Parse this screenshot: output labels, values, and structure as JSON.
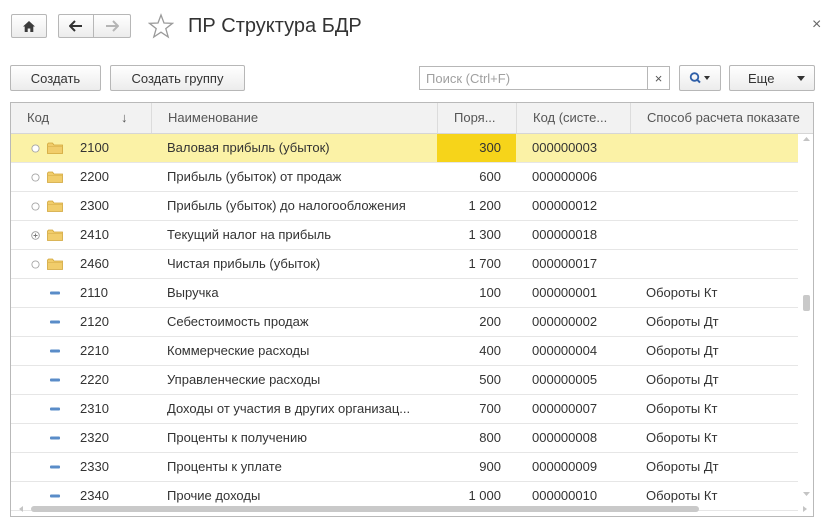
{
  "window": {
    "title": "ПР Структура БДР"
  },
  "toolbar": {
    "create_label": "Создать",
    "create_group_label": "Создать группу",
    "search_placeholder": "Поиск (Ctrl+F)",
    "search_clear_label": "×",
    "more_label": "Еще"
  },
  "table": {
    "columns": [
      "Код",
      "Наименование",
      "Поря...",
      "Код (систе...",
      "Способ расчета показате..."
    ],
    "sort_indicator": "↓",
    "rows": [
      {
        "kind": "group",
        "marker": "circle",
        "code": "2100",
        "name": "Валовая прибыль (убыток)",
        "order": "300",
        "sys_code": "000000003",
        "method": "",
        "selected": true
      },
      {
        "kind": "group",
        "marker": "circle",
        "code": "2200",
        "name": "Прибыль (убыток) от продаж",
        "order": "600",
        "sys_code": "000000006",
        "method": ""
      },
      {
        "kind": "group",
        "marker": "circle",
        "code": "2300",
        "name": "Прибыль (убыток) до налогообложения",
        "order": "1 200",
        "sys_code": "000000012",
        "method": ""
      },
      {
        "kind": "group",
        "marker": "plus",
        "code": "2410",
        "name": "Текущий налог на прибыль",
        "order": "1 300",
        "sys_code": "000000018",
        "method": ""
      },
      {
        "kind": "group",
        "marker": "circle",
        "code": "2460",
        "name": "Чистая прибыль (убыток)",
        "order": "1 700",
        "sys_code": "000000017",
        "method": ""
      },
      {
        "kind": "item",
        "code": "2110",
        "name": "Выручка",
        "order": "100",
        "sys_code": "000000001",
        "method": "Обороты Кт"
      },
      {
        "kind": "item",
        "code": "2120",
        "name": "Себестоимость продаж",
        "order": "200",
        "sys_code": "000000002",
        "method": "Обороты Дт"
      },
      {
        "kind": "item",
        "code": "2210",
        "name": "Коммерческие расходы",
        "order": "400",
        "sys_code": "000000004",
        "method": "Обороты Дт"
      },
      {
        "kind": "item",
        "code": "2220",
        "name": "Управленческие расходы",
        "order": "500",
        "sys_code": "000000005",
        "method": "Обороты Дт"
      },
      {
        "kind": "item",
        "code": "2310",
        "name": "Доходы от участия в других организац...",
        "order": "700",
        "sys_code": "000000007",
        "method": "Обороты Кт"
      },
      {
        "kind": "item",
        "code": "2320",
        "name": "Проценты к получению",
        "order": "800",
        "sys_code": "000000008",
        "method": "Обороты Кт"
      },
      {
        "kind": "item",
        "code": "2330",
        "name": "Проценты к уплате",
        "order": "900",
        "sys_code": "000000009",
        "method": "Обороты Дт"
      },
      {
        "kind": "item",
        "code": "2340",
        "name": "Прочие доходы",
        "order": "1 000",
        "sys_code": "000000010",
        "method": "Обороты Кт"
      }
    ]
  },
  "icons": {
    "home": "home-icon",
    "back": "arrow-left-icon",
    "forward": "arrow-right-icon",
    "favorite": "star-icon",
    "close": "close-icon",
    "search": "magnifier-icon",
    "folder": "folder-icon",
    "item": "item-dash-icon"
  },
  "colors": {
    "selected_row": "#fbf2a6",
    "selected_cell": "#f6d41a",
    "folder": "#e9c46a"
  }
}
